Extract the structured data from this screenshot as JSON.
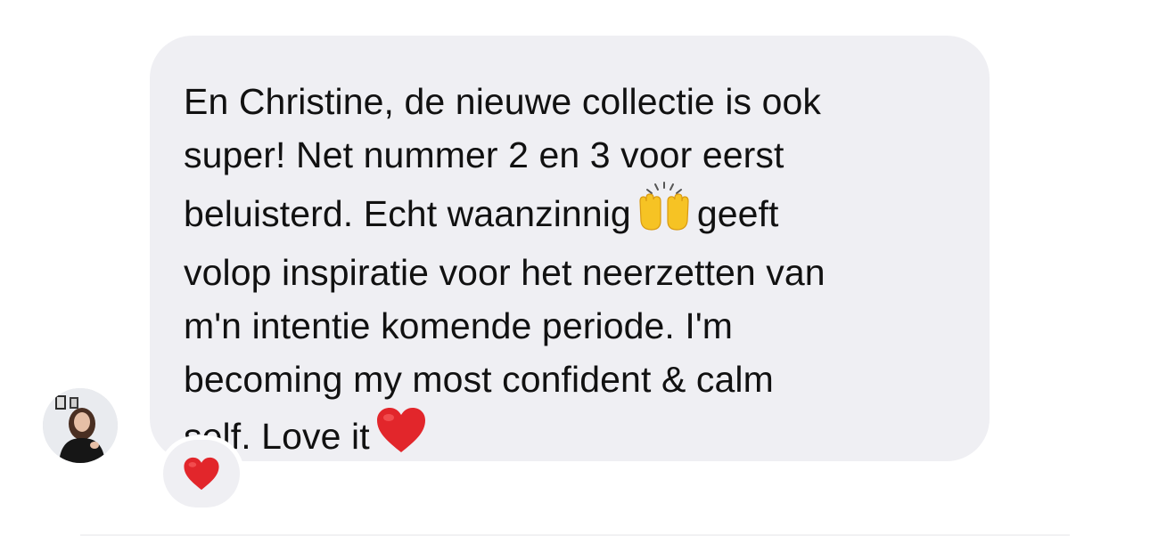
{
  "conversation": {
    "sender": {
      "avatar_icon": "user-avatar-photo"
    },
    "message": {
      "segments": [
        "En Christine, de nieuwe collectie is ook\nsuper! Net nummer 2 en 3 voor eerst\nbeluisterd. Echt waanzinnig",
        "geeft\nvolop inspiratie voor het neerzetten van\nm'n intentie komende periode. I'm\nbecoming my most confident & calm\nself. Love it"
      ],
      "emojis": [
        "raising-hands-emoji",
        "red-heart-emoji"
      ]
    },
    "reaction": {
      "emoji": "red-heart-emoji"
    }
  },
  "colors": {
    "bubble_background": "#efeff3",
    "text": "#111111",
    "heart": "#e2262b",
    "hands": "#f6c324"
  }
}
